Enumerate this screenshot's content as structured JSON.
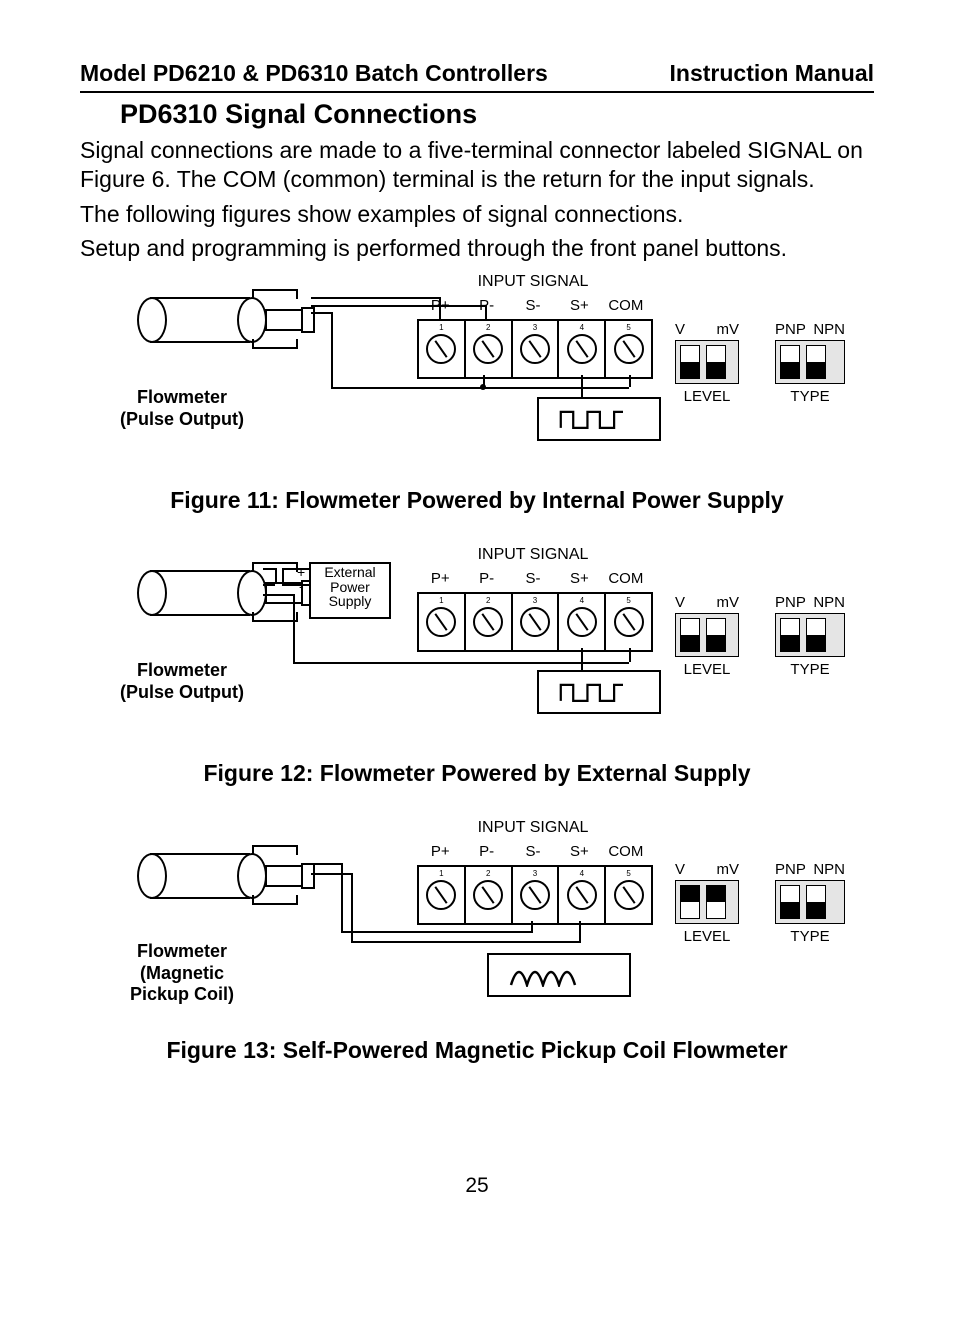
{
  "header": {
    "left": "Model PD6210 & PD6310 Batch Controllers",
    "right": "Instruction Manual"
  },
  "section_title": "PD6310 Signal Connections",
  "para1": "Signal connections are made to a five-terminal connector labeled SIGNAL on Figure 6. The COM (common) terminal is the return for the input signals.",
  "para2": "The following figures show examples of signal connections.",
  "para3": "Setup and programming is performed through the front panel buttons.",
  "terminals": {
    "title": "INPUT SIGNAL",
    "labels": [
      "P+",
      "P-",
      "S-",
      "S+",
      "COM"
    ]
  },
  "switches": {
    "level": {
      "label": "LEVEL",
      "opts": [
        "V",
        "mV"
      ]
    },
    "type": {
      "label": "TYPE",
      "opts": [
        "PNP",
        "NPN"
      ]
    }
  },
  "fig11": {
    "caption": "Figure 11: Flowmeter Powered by Internal Power Supply",
    "flowmeter_label_1": "Flowmeter",
    "flowmeter_label_2": "(Pulse Output)",
    "level_pos": "down",
    "type_pos": "down"
  },
  "fig12": {
    "caption": "Figure 12: Flowmeter Powered by External Supply",
    "flowmeter_label_1": "Flowmeter",
    "flowmeter_label_2": "(Pulse Output)",
    "supply_label": "External Power Supply",
    "supply_plus": "+",
    "supply_minus": "-",
    "level_pos": "down",
    "type_pos": "down"
  },
  "fig13": {
    "caption": "Figure 13: Self-Powered Magnetic Pickup Coil Flowmeter",
    "flowmeter_label_1": "Flowmeter",
    "flowmeter_label_2": "(Magnetic",
    "flowmeter_label_3": "Pickup Coil)",
    "level_pos": "up",
    "type_pos": "down"
  },
  "page_number": "25"
}
